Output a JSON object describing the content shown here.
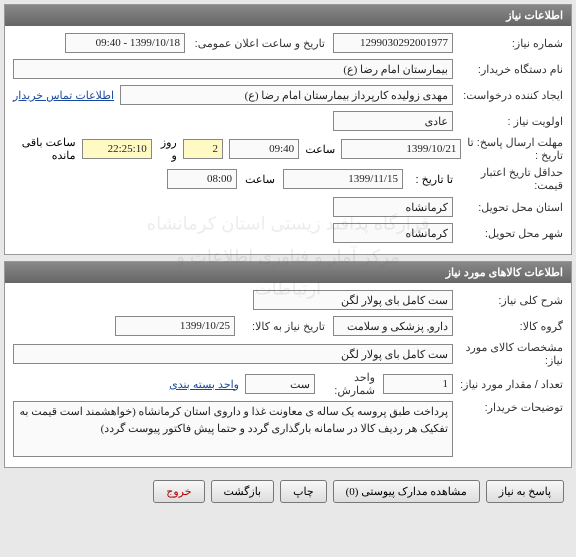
{
  "watermark": {
    "line1": "قرارگاه پدافند زیستی استان کرمانشاه",
    "line2": "مرکز آمار و فناوری اطلاعات و ارتباطات"
  },
  "panel1": {
    "title": "اطلاعات نیاز",
    "need_no_label": "شماره نیاز:",
    "need_no": "1299030292001977",
    "ann_label": "تاریخ و ساعت اعلان عمومی:",
    "ann_value": "1399/10/18 - 09:40",
    "buyer_org_label": "نام دستگاه خریدار:",
    "buyer_org": "بیمارستان امام رضا (ع)",
    "creator_label": "ایجاد کننده درخواست:",
    "creator": "مهدی زولیده کارپرداز بیمارستان امام رضا (ع)",
    "contact_link": "اطلاعات تماس خریدار",
    "priority_label": "اولویت نیاز :",
    "priority": "عادی",
    "resp_deadline_label": "مهلت ارسال پاسخ:  تا تاریخ :",
    "resp_date": "1399/10/21",
    "time_label": "ساعت",
    "resp_time": "09:40",
    "days": "2",
    "days_label": "روز و",
    "remain_time": "22:25:10",
    "remain_label": "ساعت باقی مانده",
    "min_price_label": "حداقل تاریخ اعتبار قیمت:",
    "min_price_to": "تا تاریخ :",
    "min_price_date": "1399/11/15",
    "min_price_time": "08:00",
    "province_label": "استان محل تحویل:",
    "province": "کرمانشاه",
    "city_label": "شهر محل تحویل:",
    "city": "کرمانشاه"
  },
  "panel2": {
    "title": "اطلاعات کالاهای مورد نیاز",
    "desc_label": "شرح کلی نیاز:",
    "desc": "ست کامل بای پولار لگن",
    "group_label": "گروه کالا:",
    "group": "دارو, پزشکی و سلامت",
    "need_until_label": "تاریخ نیاز به کالا:",
    "need_until": "1399/10/25",
    "spec_label": "مشخصات کالای مورد نیاز:",
    "spec": "ست کامل بای پولار لگن",
    "qty_label": "تعداد / مقدار مورد نیاز:",
    "qty": "1",
    "unit_label": "واحد شمارش:",
    "unit": "ست",
    "pack_link": "واحد بسته بندی",
    "note_label": "توضیحات خریدار:",
    "note": "پرداخت طبق پروسه یک ساله ی معاونت غذا و داروی استان کرمانشاه (خواهشمند است قیمت به تفکیک هر ردیف کالا در سامانه بارگذاری گردد و حتما پیش فاکتور پیوست گردد)"
  },
  "buttons": {
    "respond": "پاسخ به نیاز",
    "attach": "مشاهده مدارک پیوستی  (0)",
    "print": "چاپ",
    "back": "بازگشت",
    "exit": "خروج"
  }
}
